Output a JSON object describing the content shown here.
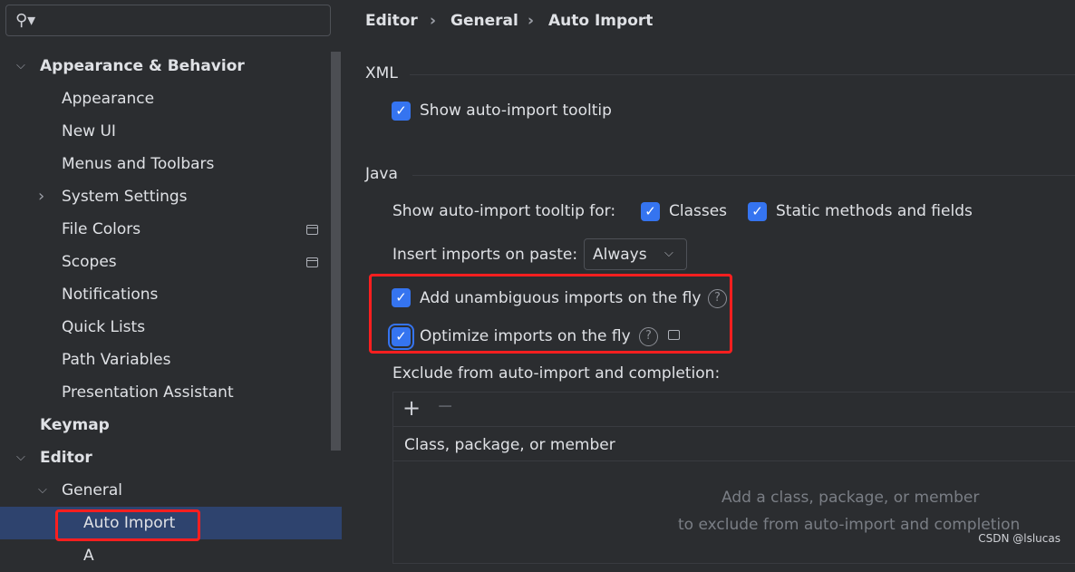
{
  "search": {
    "placeholder": "",
    "icon": "search-icon"
  },
  "tree": [
    {
      "label": "Appearance & Behavior",
      "level": 0,
      "bold": true,
      "chevron": "down"
    },
    {
      "label": "Appearance",
      "level": 1
    },
    {
      "label": "New UI",
      "level": 1
    },
    {
      "label": "Menus and Toolbars",
      "level": 1
    },
    {
      "label": "System Settings",
      "level": 1,
      "chevron": "right"
    },
    {
      "label": "File Colors",
      "level": 1,
      "project_icon": true
    },
    {
      "label": "Scopes",
      "level": 1,
      "project_icon": true
    },
    {
      "label": "Notifications",
      "level": 1
    },
    {
      "label": "Quick Lists",
      "level": 1
    },
    {
      "label": "Path Variables",
      "level": 1
    },
    {
      "label": "Presentation Assistant",
      "level": 1
    },
    {
      "label": "Keymap",
      "level": 0,
      "bold": true
    },
    {
      "label": "Editor",
      "level": 0,
      "bold": true,
      "chevron": "down"
    },
    {
      "label": "General",
      "level": 1,
      "chevron": "down"
    },
    {
      "label": "Auto Import",
      "level": 2,
      "selected": true
    },
    {
      "label": "A",
      "level": 2
    }
  ],
  "breadcrumb": [
    "Editor",
    "General",
    "Auto Import"
  ],
  "xml": {
    "title": "XML",
    "show_tooltip": {
      "label": "Show auto-import tooltip",
      "checked": true
    }
  },
  "java": {
    "title": "Java",
    "tooltip_for_label": "Show auto-import tooltip for:",
    "classes": {
      "label": "Classes",
      "checked": true
    },
    "static": {
      "label": "Static methods and fields",
      "checked": true
    },
    "insert_label": "Insert imports on paste:",
    "insert_value": "Always",
    "add_unambiguous": {
      "label": "Add unambiguous imports on the fly",
      "checked": true
    },
    "optimize": {
      "label": "Optimize imports on the fly",
      "checked": true
    },
    "exclude_label": "Exclude from auto-import and completion:",
    "table_header": "Class, package, or member",
    "empty_line1": "Add a class, package, or member",
    "empty_line2": "to exclude from auto-import and completion"
  },
  "colors": {
    "accent": "#3574f0",
    "selection": "#2e436e",
    "highlight": "#ff1f1f"
  },
  "watermark": "CSDN @lslucas"
}
